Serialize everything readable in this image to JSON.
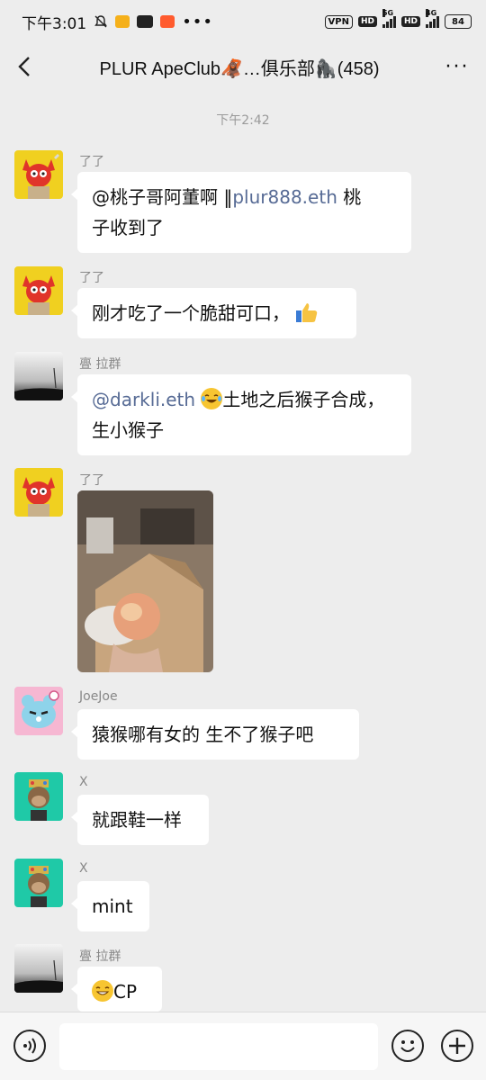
{
  "status_bar": {
    "time": "下午3:01",
    "vpn": "VPN",
    "hd": "HD",
    "net1": "5G",
    "net2": "4G",
    "battery": "84"
  },
  "header": {
    "title": "PLUR ApeClub🦧…俱乐部🦍(458)",
    "more": "···"
  },
  "timestamp": "下午2:42",
  "messages": [
    {
      "sender": "了了",
      "mention": "@桃子哥阿董啊 ‖",
      "link": "plur888.eth",
      "line1_rest": " 桃",
      "line2": "子收到了"
    },
    {
      "sender": "了了",
      "text": "刚才吃了一个脆甜可口，"
    },
    {
      "sender": "亹 拉群",
      "link": "@darkli.eth",
      "line1_rest": "土地之后猴子合成，",
      "line2": "生小猴子"
    },
    {
      "sender": "了了"
    },
    {
      "sender": "JoeJoe",
      "text": "猿猴哪有女的 生不了猴子吧"
    },
    {
      "sender": "X",
      "text": "就跟鞋一样"
    },
    {
      "sender": "X",
      "text": "mint"
    },
    {
      "sender": "亹 拉群",
      "text": "CP"
    }
  ],
  "colors": {
    "background": "#ededed",
    "bubble": "#ffffff",
    "link": "#576b95",
    "timestamp": "#9a9a9a"
  },
  "icons": [
    "back-arrow-icon",
    "more-dots-icon",
    "voice-icon",
    "emoji-icon",
    "plus-icon"
  ]
}
